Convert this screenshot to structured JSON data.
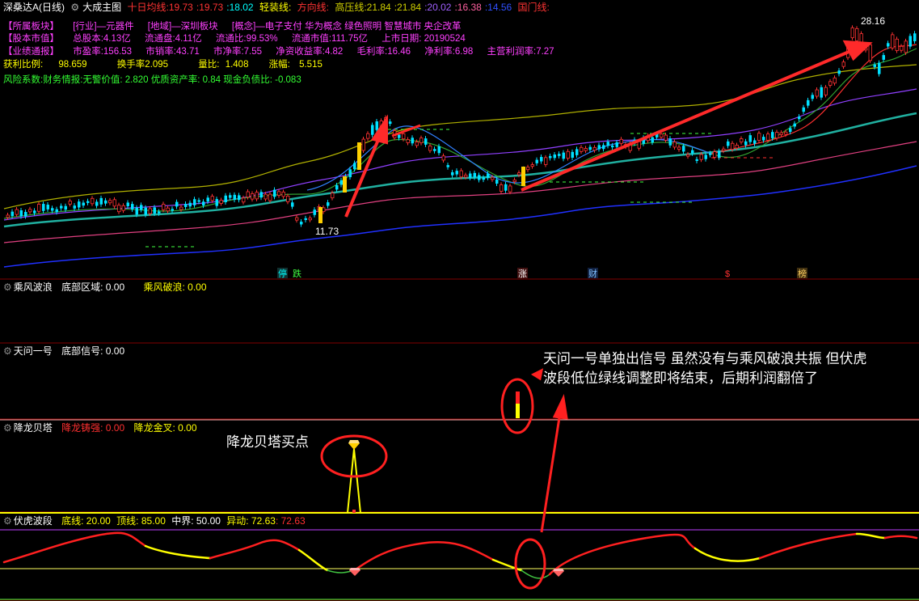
{
  "header": {
    "stock_name": "深桑达A",
    "period": "(日线)",
    "indicator": "大成主图",
    "ma_label": "十日均线:",
    "ma_v1": "19.73",
    "ma_v2": "19.73",
    "ma_v3": "18.02",
    "light_label": "轻装线:",
    "dir_label": "方向线:",
    "hp_label": "高压线:",
    "hp_v1": "21.84",
    "hp_v2": "21.84",
    "v_purple": "20.02",
    "v_pink": "16.38",
    "v_blue": "14.56",
    "gm_label": "国门线:"
  },
  "info": {
    "row1": [
      "【所属板块】",
      "[行业]—元器件",
      "[地域]—深圳板块",
      "[概念]—电子支付 华为概念 绿色照明 智慧城市 央企改革"
    ],
    "row2": [
      "【股本市值】",
      "总股本:4.13亿",
      "流通盘:4.11亿",
      "流通比:99.53%",
      "流通市值:111.75亿",
      "上市日期: 20190524"
    ],
    "row3": [
      "【业绩通报】",
      "市盈率:156.53",
      "市销率:43.71",
      "市净率:7.55",
      "净资收益率:4.82",
      "毛利率:16.46",
      "净利率:6.98",
      "主营利润率:7.27"
    ],
    "row4": [
      "获利比例:",
      "98.659",
      "换手率2.095",
      "量比:",
      "1.408",
      "涨幅:",
      "5.515"
    ],
    "row5": "风险系数:财务情报:无警价值: 2.820 优质资产率: 0.84 现金负债比: -0.083"
  },
  "price_marks": {
    "high": "28.16",
    "low": "11.73"
  },
  "badges": [
    "停",
    "跌",
    "涨",
    "财",
    "$",
    "榜"
  ],
  "panels": {
    "p1": {
      "name": "乘风波浪",
      "l1": "底部区域: 0.00",
      "l2": "乘风破浪: 0.00"
    },
    "p2": {
      "name": "天问一号",
      "l1": "底部信号: 0.00"
    },
    "p3": {
      "name": "降龙贝塔",
      "l1": "降龙铸强: 0.00",
      "l2": "降龙金叉: 0.00"
    },
    "p4": {
      "name": "伏虎波段",
      "l1": "底线: 20.00",
      "l2": "顶线: 85.00",
      "l3": "中界: 50.00",
      "l4": "异动: 72.63",
      "l5": ": 72.63"
    }
  },
  "annotations": {
    "tianwen_line1": "天问一号单独出信号 虽然没有与乘风破浪共振 但伏虎",
    "tianwen_line2": "波段低位绿线调整即将结束，后期利润翻倍了",
    "xianglong": "降龙贝塔买点"
  },
  "colors": {
    "up": "#ff3333",
    "down": "#00ffff",
    "annot": "#ff2020",
    "yellow": "#ffff00"
  }
}
